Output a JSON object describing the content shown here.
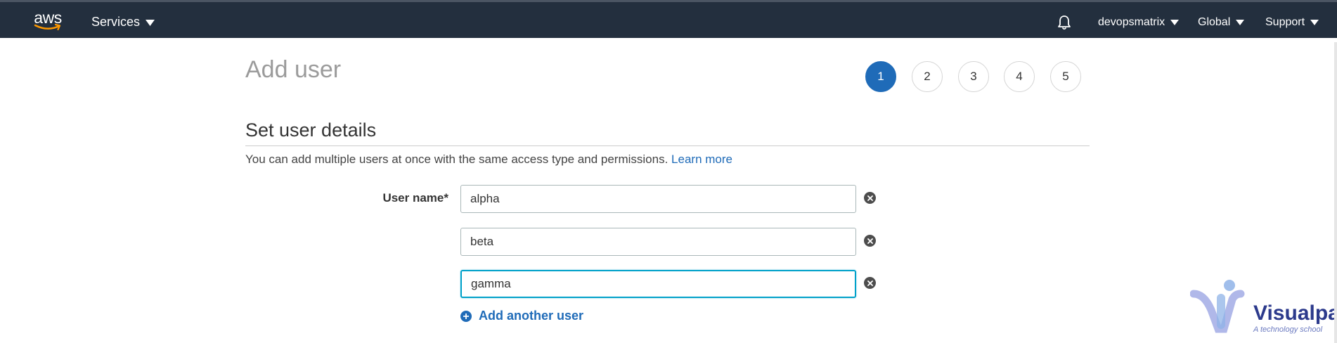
{
  "topbar": {
    "logo_text": "aws",
    "services_label": "Services",
    "account_label": "devopsmatrix",
    "region_label": "Global",
    "support_label": "Support",
    "bell_icon": "bell-icon",
    "caret_icon": "caret-down-icon"
  },
  "page": {
    "title": "Add user",
    "steps": [
      "1",
      "2",
      "3",
      "4",
      "5"
    ],
    "active_step": "1"
  },
  "section": {
    "title": "Set user details",
    "description": "You can add multiple users at once with the same access type and permissions.",
    "learn_more": "Learn more"
  },
  "form": {
    "user_name_label": "User name*",
    "users": [
      {
        "value": "alpha",
        "focused": false
      },
      {
        "value": "beta",
        "focused": false
      },
      {
        "value": "gamma",
        "focused": true
      }
    ],
    "remove_icon": "close-circle-icon",
    "add_icon": "plus-circle-icon",
    "add_another_label": "Add another user"
  },
  "watermark": {
    "name": "Visualpath",
    "tagline": "A technology school"
  },
  "colors": {
    "nav_bg": "#232f3e",
    "accent": "#1f6bb8",
    "focus": "#00a1c9"
  }
}
